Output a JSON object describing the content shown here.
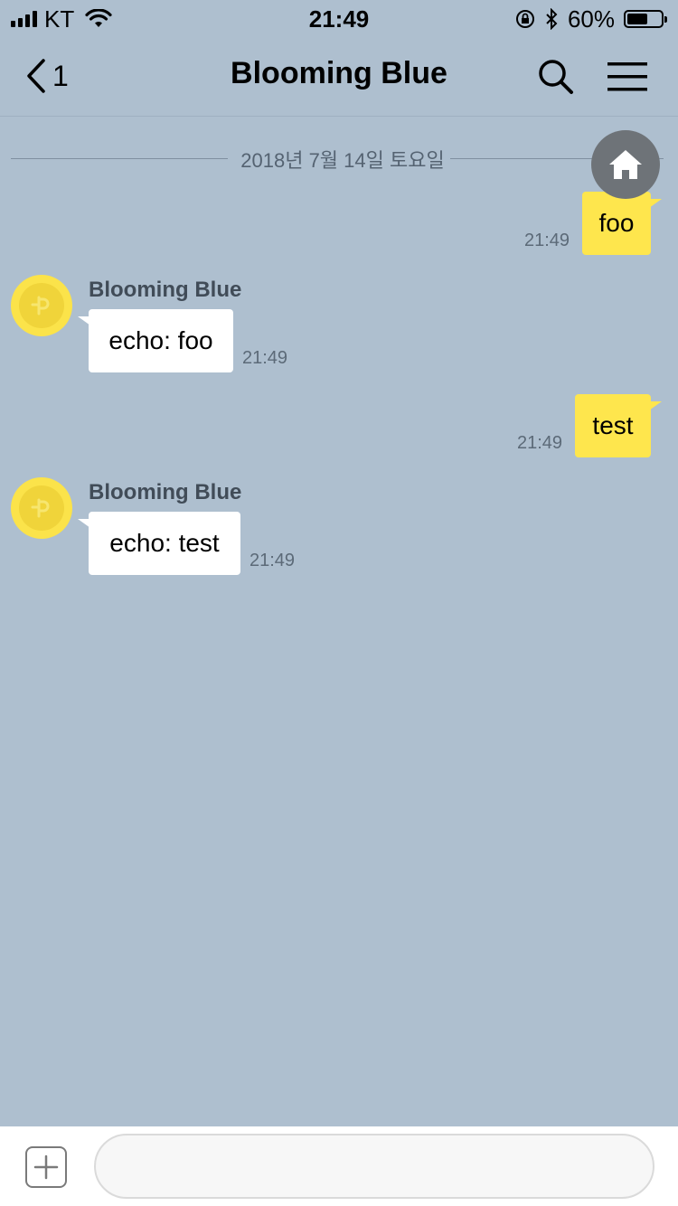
{
  "status_bar": {
    "carrier": "KT",
    "time": "21:49",
    "battery_percent": "60%",
    "battery_level": 0.6
  },
  "header": {
    "back_count": "1",
    "title": "Blooming Blue"
  },
  "date_divider": "2018년 7월 14일 토요일",
  "messages": [
    {
      "from": "me",
      "text": "foo",
      "time": "21:49"
    },
    {
      "from": "bot",
      "sender": "Blooming Blue",
      "text": "echo: foo",
      "time": "21:49"
    },
    {
      "from": "me",
      "text": "test",
      "time": "21:49"
    },
    {
      "from": "bot",
      "sender": "Blooming Blue",
      "text": "echo: test",
      "time": "21:49"
    }
  ],
  "input": {
    "placeholder": "",
    "value": ""
  },
  "colors": {
    "background": "#aebfcf",
    "my_bubble": "#fee64d",
    "their_bubble": "#ffffff",
    "avatar": "#fbe34a"
  },
  "icons": {
    "back": "chevron-left-icon",
    "search": "search-icon",
    "menu": "hamburger-menu-icon",
    "home": "home-icon",
    "plus": "plus-icon"
  }
}
